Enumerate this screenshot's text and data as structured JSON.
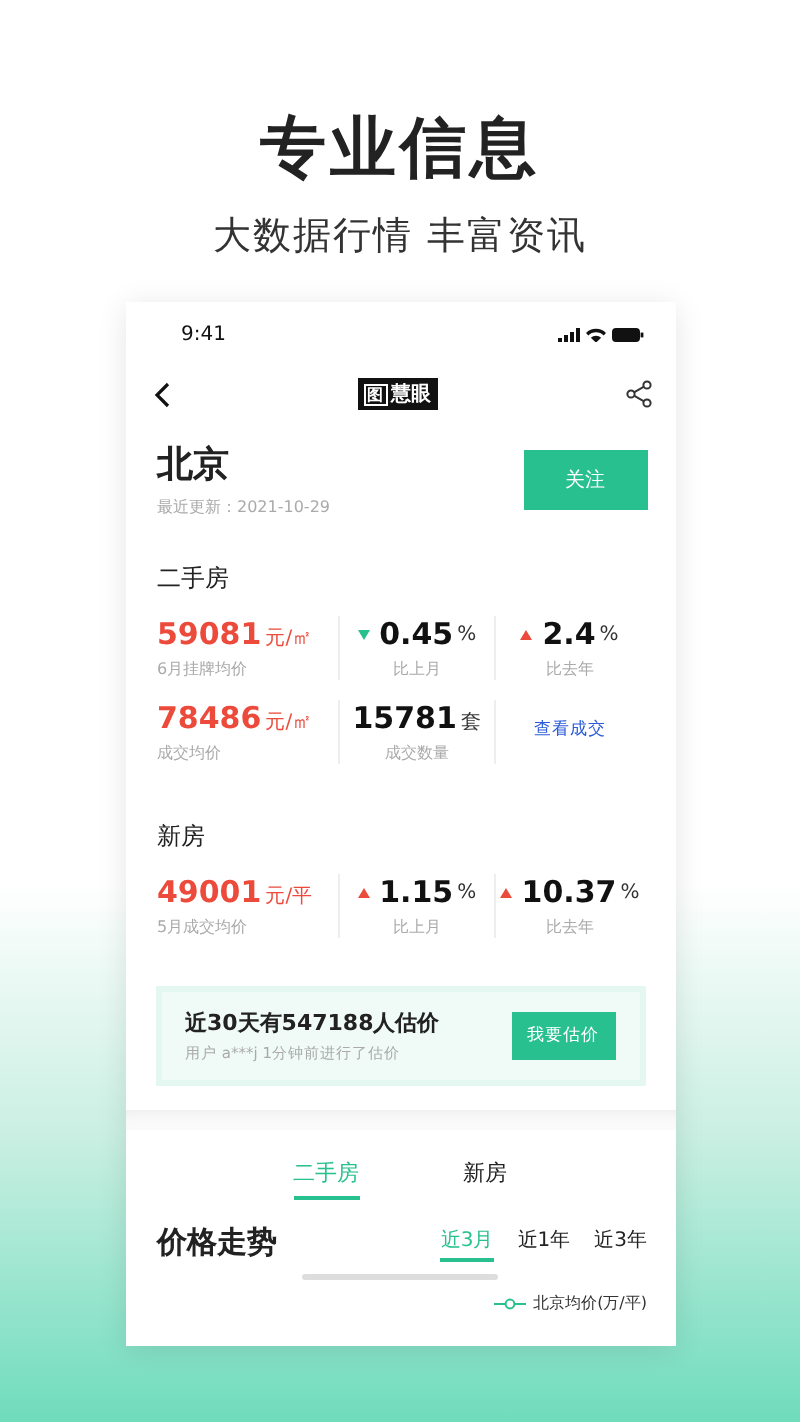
{
  "headline": "专业信息",
  "subtitle": "大数据行情 丰富资讯",
  "status_bar": {
    "time": "9:41"
  },
  "nav": {
    "logo_mark": "图",
    "logo_text": "慧眼"
  },
  "city": {
    "name": "北京",
    "updated": "最近更新：2021-10-29",
    "follow_button": "关注"
  },
  "sections": [
    {
      "title": "二手房",
      "rows": [
        [
          {
            "kind": "price",
            "value": "59081",
            "unit": "元/㎡",
            "label": "6月挂牌均价"
          },
          {
            "kind": "change",
            "rising": false,
            "value": "0.45",
            "unit": "%",
            "label": "比上月"
          },
          {
            "kind": "change",
            "rising": true,
            "value": "2.4",
            "unit": "%",
            "label": "比去年"
          }
        ],
        [
          {
            "kind": "price",
            "value": "78486",
            "unit": "元/㎡",
            "label": "成交均价"
          },
          {
            "kind": "count",
            "value": "15781",
            "unit": "套",
            "label": "成交数量"
          },
          {
            "kind": "link",
            "value": "查看成交"
          }
        ]
      ]
    },
    {
      "title": "新房",
      "rows": [
        [
          {
            "kind": "price",
            "value": "49001",
            "unit": "元/平",
            "label": "5月成交均价"
          },
          {
            "kind": "change",
            "rising": true,
            "value": "1.15",
            "unit": "%",
            "label": "比上月"
          },
          {
            "kind": "change",
            "rising": true,
            "value": "10.37",
            "unit": "%",
            "label": "比去年"
          }
        ]
      ]
    }
  ],
  "estimate": {
    "title": "近30天有547188人估价",
    "note": "用户 a***j 1分钟前进行了估价",
    "button": "我要估价"
  },
  "tabs": [
    {
      "label": "二手房",
      "selected": true
    },
    {
      "label": "新房",
      "selected": false
    }
  ],
  "trend": {
    "title": "价格走势",
    "ranges": [
      {
        "label": "近3月",
        "selected": true
      },
      {
        "label": "近1年",
        "selected": false
      },
      {
        "label": "近3年",
        "selected": false
      }
    ],
    "legend": "北京均价(万/平)"
  }
}
